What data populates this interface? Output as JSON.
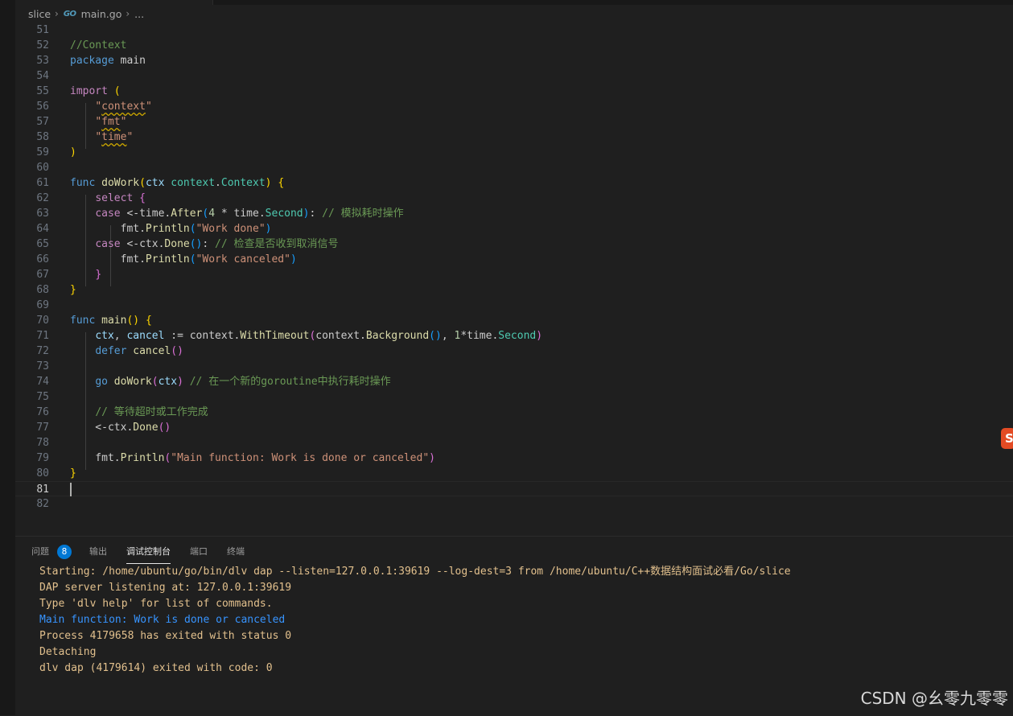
{
  "breadcrumb": {
    "folder": "slice",
    "file": "main.go",
    "ellipsis": "...",
    "file_icon": "GO"
  },
  "editor": {
    "lines": [
      {
        "n": "51",
        "tokens": []
      },
      {
        "n": "52",
        "tokens": [
          [
            "cm",
            "//Context"
          ]
        ]
      },
      {
        "n": "53",
        "tokens": [
          [
            "k",
            "package"
          ],
          [
            "p",
            " main"
          ]
        ]
      },
      {
        "n": "54",
        "tokens": []
      },
      {
        "n": "55",
        "tokens": [
          [
            "c",
            "import"
          ],
          [
            "p",
            " "
          ],
          [
            "b1",
            "("
          ]
        ]
      },
      {
        "n": "56",
        "tokens": [
          [
            "p",
            "    "
          ],
          [
            "s",
            "\""
          ],
          [
            "s u",
            "context"
          ],
          [
            "s",
            "\""
          ]
        ]
      },
      {
        "n": "57",
        "tokens": [
          [
            "p",
            "    "
          ],
          [
            "s",
            "\""
          ],
          [
            "s u",
            "fmt"
          ],
          [
            "s",
            "\""
          ]
        ]
      },
      {
        "n": "58",
        "tokens": [
          [
            "p",
            "    "
          ],
          [
            "s",
            "\""
          ],
          [
            "s u",
            "time"
          ],
          [
            "s",
            "\""
          ]
        ]
      },
      {
        "n": "59",
        "tokens": [
          [
            "b1",
            ")"
          ]
        ]
      },
      {
        "n": "60",
        "tokens": []
      },
      {
        "n": "61",
        "tokens": [
          [
            "k",
            "func"
          ],
          [
            "p",
            " "
          ],
          [
            "f",
            "doWork"
          ],
          [
            "b1",
            "("
          ],
          [
            "v",
            "ctx"
          ],
          [
            "p",
            " "
          ],
          [
            "t",
            "context"
          ],
          [
            "p",
            "."
          ],
          [
            "t",
            "Context"
          ],
          [
            "b1",
            ")"
          ],
          [
            "p",
            " "
          ],
          [
            "b1",
            "{"
          ]
        ]
      },
      {
        "n": "62",
        "tokens": [
          [
            "p",
            "    "
          ],
          [
            "c",
            "select"
          ],
          [
            "p",
            " "
          ],
          [
            "b2",
            "{"
          ]
        ]
      },
      {
        "n": "63",
        "tokens": [
          [
            "p",
            "    "
          ],
          [
            "c",
            "case"
          ],
          [
            "p",
            " <-time."
          ],
          [
            "f",
            "After"
          ],
          [
            "b3",
            "("
          ],
          [
            "n",
            "4"
          ],
          [
            "p",
            " * time."
          ],
          [
            "t",
            "Second"
          ],
          [
            "b3",
            ")"
          ],
          [
            "p",
            ": "
          ],
          [
            "cm",
            "// 模拟耗时操作"
          ]
        ]
      },
      {
        "n": "64",
        "tokens": [
          [
            "p",
            "        fmt."
          ],
          [
            "f",
            "Println"
          ],
          [
            "b3",
            "("
          ],
          [
            "s",
            "\"Work done\""
          ],
          [
            "b3",
            ")"
          ]
        ]
      },
      {
        "n": "65",
        "tokens": [
          [
            "p",
            "    "
          ],
          [
            "c",
            "case"
          ],
          [
            "p",
            " <-ctx."
          ],
          [
            "f",
            "Done"
          ],
          [
            "b3",
            "()"
          ],
          [
            "p",
            ": "
          ],
          [
            "cm",
            "// 检查是否收到取消信号"
          ]
        ]
      },
      {
        "n": "66",
        "tokens": [
          [
            "p",
            "        fmt."
          ],
          [
            "f",
            "Println"
          ],
          [
            "b3",
            "("
          ],
          [
            "s",
            "\"Work canceled\""
          ],
          [
            "b3",
            ")"
          ]
        ]
      },
      {
        "n": "67",
        "tokens": [
          [
            "p",
            "    "
          ],
          [
            "b2",
            "}"
          ]
        ]
      },
      {
        "n": "68",
        "tokens": [
          [
            "b1",
            "}"
          ]
        ]
      },
      {
        "n": "69",
        "tokens": []
      },
      {
        "n": "70",
        "tokens": [
          [
            "k",
            "func"
          ],
          [
            "p",
            " "
          ],
          [
            "f",
            "main"
          ],
          [
            "b1",
            "()"
          ],
          [
            "p",
            " "
          ],
          [
            "b1",
            "{"
          ]
        ]
      },
      {
        "n": "71",
        "tokens": [
          [
            "p",
            "    "
          ],
          [
            "v",
            "ctx"
          ],
          [
            "p",
            ", "
          ],
          [
            "v",
            "cancel"
          ],
          [
            "p",
            " := context."
          ],
          [
            "f",
            "WithTimeout"
          ],
          [
            "b2",
            "("
          ],
          [
            "p",
            "context."
          ],
          [
            "f",
            "Background"
          ],
          [
            "b3",
            "()"
          ],
          [
            "p",
            ", "
          ],
          [
            "n",
            "1"
          ],
          [
            "p",
            "*time."
          ],
          [
            "t",
            "Second"
          ],
          [
            "b2",
            ")"
          ]
        ]
      },
      {
        "n": "72",
        "tokens": [
          [
            "p",
            "    "
          ],
          [
            "k",
            "defer"
          ],
          [
            "p",
            " "
          ],
          [
            "f",
            "cancel"
          ],
          [
            "b2",
            "()"
          ]
        ]
      },
      {
        "n": "73",
        "tokens": []
      },
      {
        "n": "74",
        "tokens": [
          [
            "p",
            "    "
          ],
          [
            "k",
            "go"
          ],
          [
            "p",
            " "
          ],
          [
            "f",
            "doWork"
          ],
          [
            "b2",
            "("
          ],
          [
            "v",
            "ctx"
          ],
          [
            "b2",
            ")"
          ],
          [
            "p",
            " "
          ],
          [
            "cm",
            "// 在一个新的goroutine中执行耗时操作"
          ]
        ]
      },
      {
        "n": "75",
        "tokens": []
      },
      {
        "n": "76",
        "tokens": [
          [
            "p",
            "    "
          ],
          [
            "cm",
            "// 等待超时或工作完成"
          ]
        ]
      },
      {
        "n": "77",
        "tokens": [
          [
            "p",
            "    <-ctx."
          ],
          [
            "f",
            "Done"
          ],
          [
            "b2",
            "()"
          ]
        ]
      },
      {
        "n": "78",
        "tokens": []
      },
      {
        "n": "79",
        "tokens": [
          [
            "p",
            "    fmt."
          ],
          [
            "f",
            "Println"
          ],
          [
            "b2",
            "("
          ],
          [
            "s",
            "\"Main function: Work is done or canceled\""
          ],
          [
            "b2",
            ")"
          ]
        ]
      },
      {
        "n": "80",
        "tokens": [
          [
            "b1",
            "}"
          ]
        ]
      },
      {
        "n": "81",
        "tokens": [],
        "current": true
      },
      {
        "n": "82",
        "tokens": []
      }
    ]
  },
  "panel": {
    "tabs": [
      {
        "label": "问题",
        "badge": "8"
      },
      {
        "label": "输出"
      },
      {
        "label": "调试控制台",
        "active": true
      },
      {
        "label": "端口"
      },
      {
        "label": "终端"
      }
    ],
    "output": [
      {
        "style": "o-y",
        "text": "Starting: /home/ubuntu/go/bin/dlv dap --listen=127.0.0.1:39619 --log-dest=3 from /home/ubuntu/C++数据结构面试必看/Go/slice"
      },
      {
        "style": "o-y",
        "text": "DAP server listening at: 127.0.0.1:39619"
      },
      {
        "style": "o-y",
        "text": "Type 'dlv help' for list of commands."
      },
      {
        "style": "o-b",
        "text": "Main function: Work is done or canceled"
      },
      {
        "style": "o-y",
        "text": "Process 4179658 has exited with status 0"
      },
      {
        "style": "o-y",
        "text": "Detaching"
      },
      {
        "style": "o-y",
        "text": "dlv dap (4179614) exited with code: 0"
      }
    ]
  },
  "overlay": {
    "minimap_logo": "S",
    "watermark": "CSDN @幺零九零零"
  }
}
